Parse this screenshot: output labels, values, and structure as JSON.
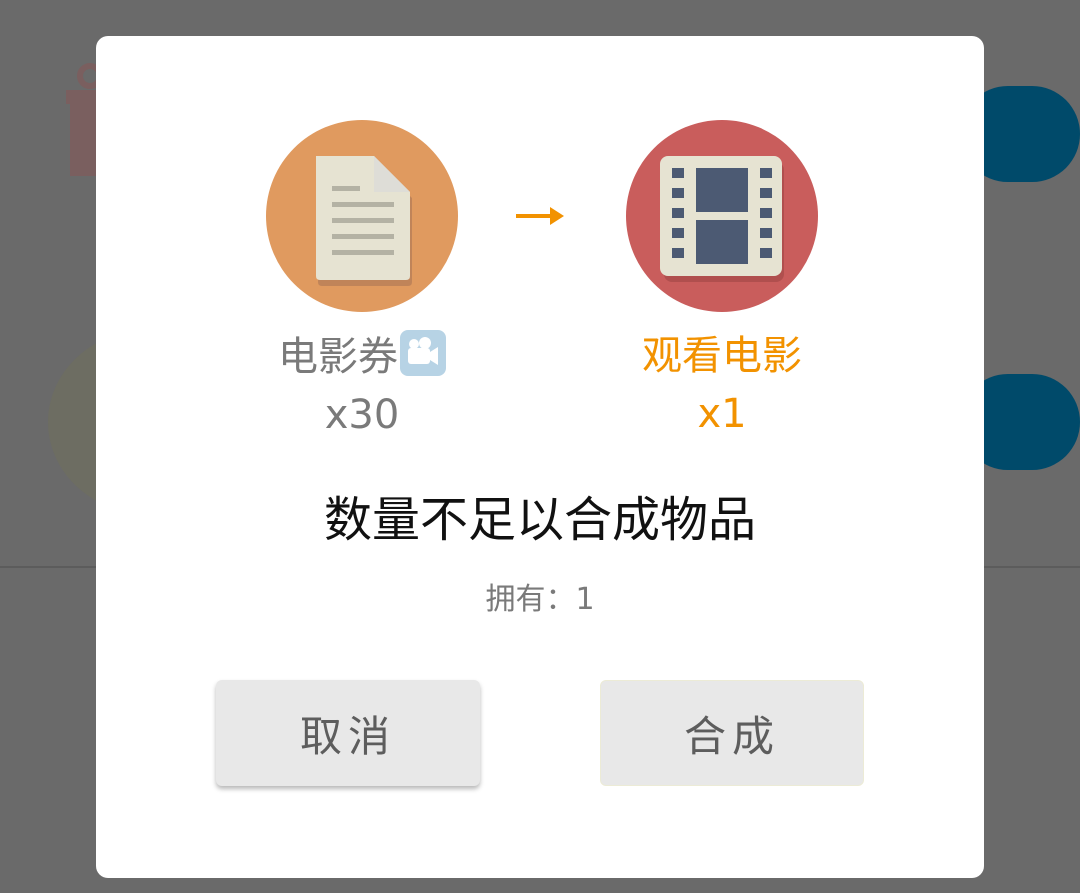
{
  "colors": {
    "accent": "#f29200",
    "source_circle": "#e09a5f",
    "target_circle": "#c95d5c",
    "overlay": "#6a6a6a"
  },
  "dialog": {
    "source": {
      "icon": "document-icon",
      "name": "电影券",
      "emoji_icon": "movie-camera-icon",
      "quantity": "x30"
    },
    "arrow_icon": "right-arrow-icon",
    "target": {
      "icon": "film-icon",
      "name": "观看电影",
      "quantity": "x1"
    },
    "message": "数量不足以合成物品",
    "owned": "拥有：1",
    "buttons": {
      "cancel": "取消",
      "compose": "合成"
    }
  }
}
